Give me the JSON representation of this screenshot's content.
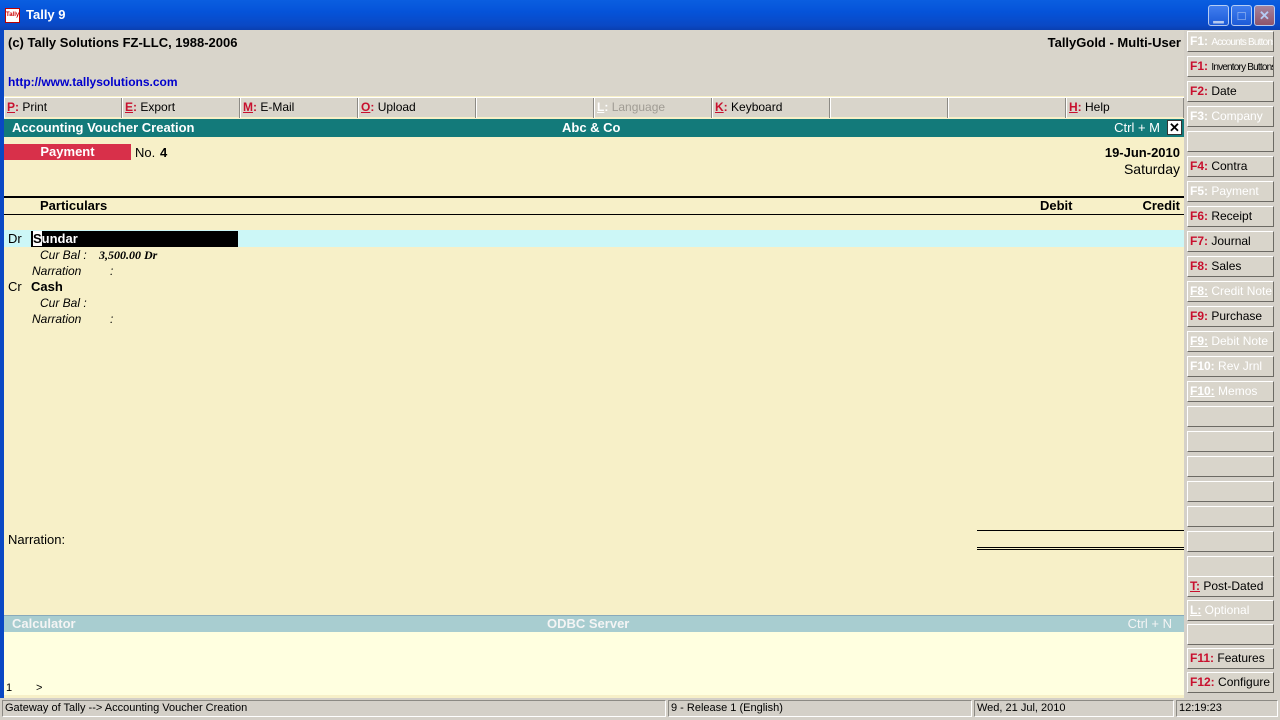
{
  "window": {
    "title": "Tally 9",
    "icon_text": "Tally"
  },
  "info": {
    "copyright": "(c) Tally Solutions FZ-LLC, 1988-2006",
    "product": "TallyGold - Multi-User",
    "url": "http://www.tallysolutions.com"
  },
  "menu": [
    {
      "key": "P",
      "label": "Print"
    },
    {
      "key": "E",
      "label": "Export"
    },
    {
      "key": "M",
      "label": "E-Mail"
    },
    {
      "key": "O",
      "label": "Upload"
    },
    {
      "key": "",
      "label": ""
    },
    {
      "key": "L",
      "label": "Language"
    },
    {
      "key": "K",
      "label": "Keyboard"
    },
    {
      "key": "",
      "label": ""
    },
    {
      "key": "",
      "label": ""
    },
    {
      "key": "H",
      "label": "Help"
    }
  ],
  "header": {
    "title": "Accounting Voucher  Creation",
    "company": "Abc & Co",
    "shortcut": "Ctrl + M",
    "close": "✕"
  },
  "voucher": {
    "type": "Payment",
    "no_label": "No.",
    "no": "4",
    "date": "19-Jun-2010",
    "day": "Saturday"
  },
  "columns": {
    "particulars": "Particulars",
    "debit": "Debit",
    "credit": "Credit"
  },
  "entries": [
    {
      "drcr": "Dr",
      "ledger_first": "S",
      "ledger_rest": "undar",
      "cur_bal_label": "Cur Bal :",
      "cur_bal": "3,500.00 Dr",
      "narration_label": "Narration",
      "colon": ":"
    },
    {
      "drcr": "Cr",
      "ledger": "Cash",
      "cur_bal_label": "Cur Bal :",
      "cur_bal": "",
      "narration_label": "Narration",
      "colon": ":"
    }
  ],
  "narration_label": "Narration:",
  "calculator": {
    "title": "Calculator",
    "server": "ODBC Server",
    "shortcut": "Ctrl + N",
    "line_no": "1",
    "prompt": ">"
  },
  "status": {
    "path": "Gateway of Tally --> Accounting Voucher  Creation",
    "release": "9 - Release 1 (English)",
    "date": "Wed, 21 Jul, 2010",
    "time": "12:19:23"
  },
  "side_buttons": [
    {
      "key": "F1:",
      "label": "Accounts Buttons",
      "dim": true,
      "tiny": true
    },
    {
      "key": "F1:",
      "label": "Inventory Buttons",
      "dim": false,
      "tiny": true
    },
    {
      "key": "F2:",
      "label": "Date",
      "dim": false
    },
    {
      "key": "F3:",
      "label": "Company",
      "dim": true
    },
    {
      "key": "",
      "label": "",
      "dim": true
    },
    {
      "key": "F4:",
      "label": "Contra",
      "dim": false
    },
    {
      "key": "F5:",
      "label": "Payment",
      "dim": true
    },
    {
      "key": "F6:",
      "label": "Receipt",
      "dim": false
    },
    {
      "key": "F7:",
      "label": "Journal",
      "dim": false
    },
    {
      "key": "F8:",
      "label": "Sales",
      "dim": false
    },
    {
      "key": "F8:",
      "label": "Credit Note",
      "dim": true,
      "underline": true
    },
    {
      "key": "F9:",
      "label": "Purchase",
      "dim": false
    },
    {
      "key": "F9:",
      "label": "Debit Note",
      "dim": true,
      "underline": true
    },
    {
      "key": "F10:",
      "label": "Rev Jrnl",
      "dim": true
    },
    {
      "key": "F10:",
      "label": "Memos",
      "dim": true,
      "underline": true
    },
    {
      "key": "",
      "label": "",
      "dim": true
    },
    {
      "key": "",
      "label": "",
      "dim": true
    },
    {
      "key": "",
      "label": "",
      "dim": true
    },
    {
      "key": "",
      "label": "",
      "dim": true
    },
    {
      "key": "",
      "label": "",
      "dim": true
    },
    {
      "key": "",
      "label": "",
      "dim": true
    },
    {
      "key": "",
      "label": "",
      "dim": true
    },
    {
      "key": "T:",
      "label": "Post-Dated",
      "dim": false,
      "underline": true
    },
    {
      "key": "L:",
      "label": "Optional",
      "dim": true,
      "underline": true
    },
    {
      "key": "",
      "label": "",
      "dim": true
    },
    {
      "key": "F11:",
      "label": "Features",
      "dim": false
    },
    {
      "key": "F12:",
      "label": "Configure",
      "dim": false
    }
  ],
  "colors": {
    "title_blue": "#0553d9",
    "header_teal": "#137a7a",
    "voucher_red": "#d8304a",
    "body_bg": "#f7f0c8",
    "selected_row": "#ccf7f7",
    "key_red": "#c8102e"
  }
}
